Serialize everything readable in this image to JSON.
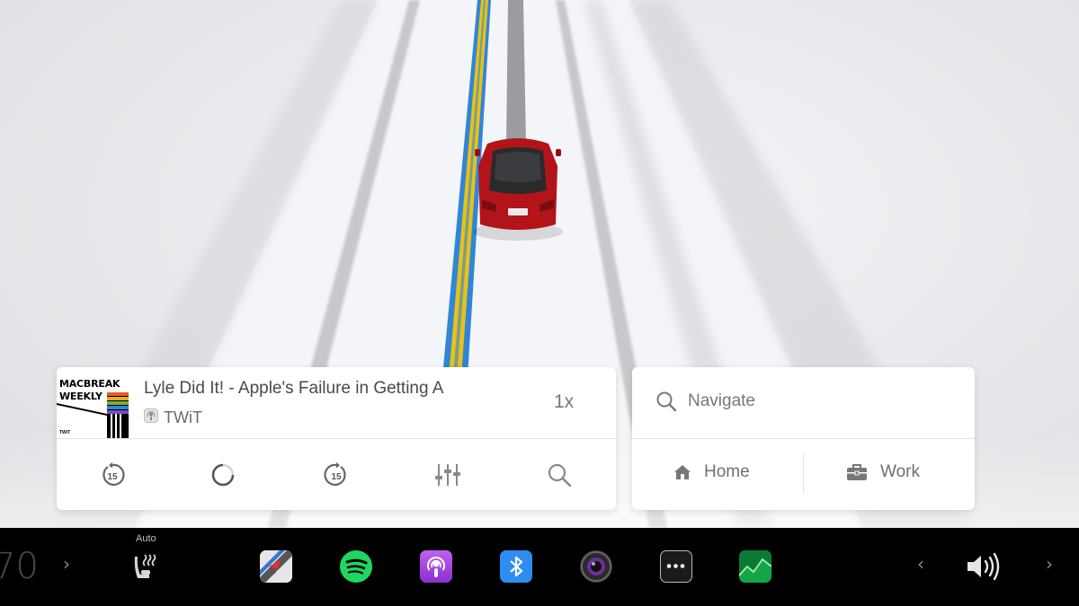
{
  "media": {
    "album_art": {
      "line1": "MACBREAK",
      "line2": "WEEKLY",
      "small": "TWiT"
    },
    "episode_title": "Lyle Did It! - Apple's Failure in Getting A",
    "source": "TWiT",
    "speed": "1x",
    "controls": [
      "skip-back-15",
      "loading",
      "skip-forward-15",
      "equalizer",
      "search"
    ],
    "skip_seconds": "15"
  },
  "navigation": {
    "search_placeholder": "Navigate",
    "destinations": [
      {
        "label": "Home",
        "icon": "home-icon"
      },
      {
        "label": "Work",
        "icon": "briefcase-icon"
      }
    ]
  },
  "taskbar": {
    "temperature": "70",
    "seat_heater_label": "Auto",
    "apps": [
      "navigation-app",
      "spotify-app",
      "podcasts-app",
      "bluetooth-app",
      "camera-app",
      "more-app",
      "stocks-app"
    ],
    "volume_icon": "volume-icon"
  },
  "colors": {
    "route_blue": "#2f86d8",
    "route_yellow": "#e8c11a",
    "car_red": "#b3141a",
    "spotify_green": "#1ed760",
    "podcasts_purple": "#a24ad9",
    "bluetooth_blue": "#2f8cf0",
    "stocks_green": "#0b8a3a"
  }
}
